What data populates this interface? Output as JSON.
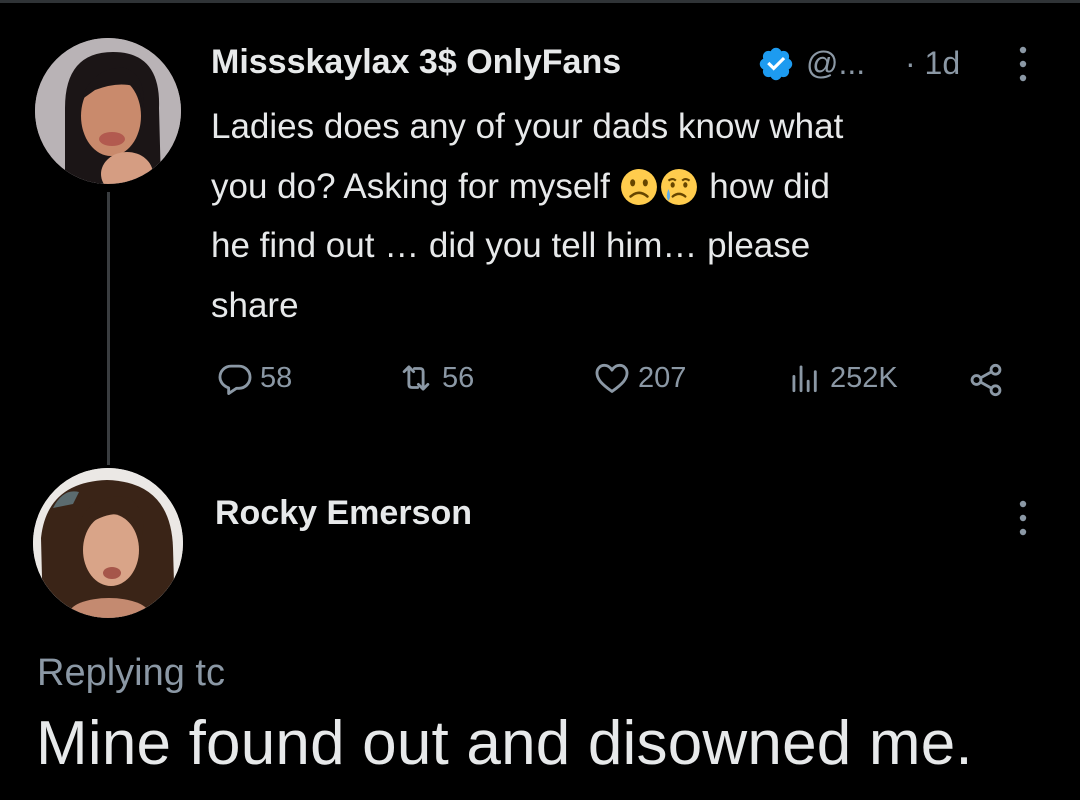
{
  "tweet": {
    "author_name": "Missskaylax 3$ OnlyFans",
    "handle": "@...",
    "time": "· 1d",
    "text_line1": "Ladies does any of your dads know what",
    "text_line2a": "you do? Asking for myself",
    "text_line2b": "how did",
    "text_line3": "he find out … did you tell him… please",
    "text_line4": "share",
    "emojis": [
      "slightly-frowning-face-emoji",
      "crying-face-emoji"
    ],
    "actions": {
      "replies": "58",
      "retweets": "56",
      "likes": "207",
      "views": "252K"
    }
  },
  "reply": {
    "author_name": "Rocky Emerson",
    "replying_to": "Replying tc",
    "text": "Mine found out and disowned me."
  },
  "colors": {
    "background": "#000000",
    "text": "#e7e9ea",
    "muted": "#8b98a5",
    "verified": "#1d9bf0"
  }
}
